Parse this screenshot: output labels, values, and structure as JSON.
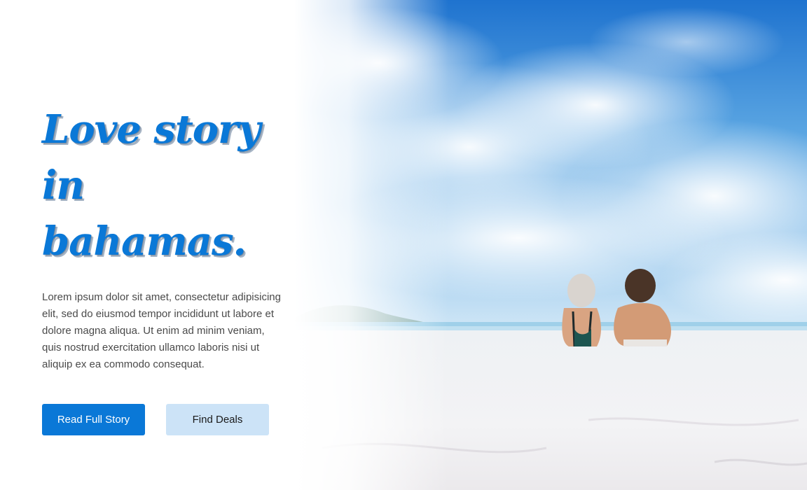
{
  "hero": {
    "title_line1": "Love story in",
    "title_line2": "bahamas.",
    "description": "Lorem ipsum dolor sit amet, consectetur adipisicing elit, sed do eiusmod tempor incididunt ut labore et dolore magna aliqua. Ut enim ad minim veniam, quis nostrud exercitation ullamco laboris nisi ut aliquip ex ea commodo consequat.",
    "primary_button": "Read Full Story",
    "secondary_button": "Find Deals"
  },
  "colors": {
    "accent": "#0a78d7",
    "secondary_button_bg": "#cce3f7",
    "body_text": "#4a4a4a",
    "sky": "#2f86d6",
    "sand": "#f4f4f6"
  },
  "image": {
    "subject": "beach-couple-photo"
  }
}
